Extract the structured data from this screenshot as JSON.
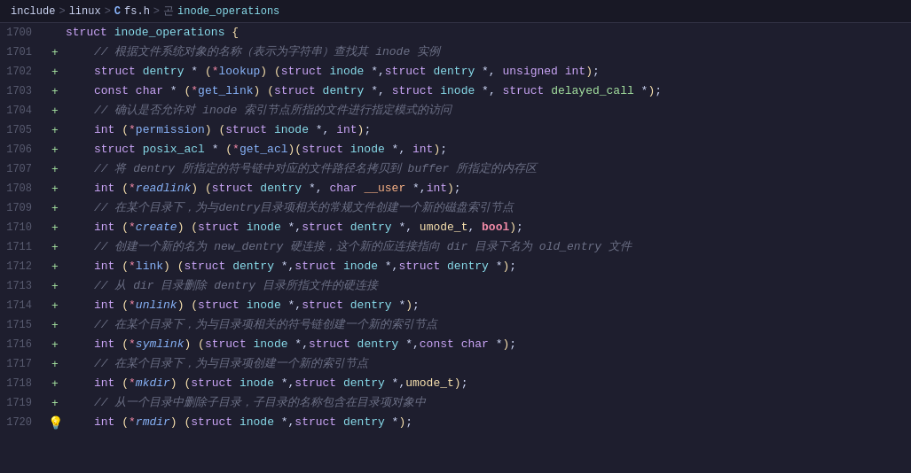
{
  "breadcrumb": {
    "items": [
      "include",
      "linux",
      "fs.h",
      "inode_operations"
    ],
    "separators": [
      ">",
      ">",
      ">"
    ],
    "c_label": "C"
  },
  "lines": [
    {
      "number": "1700",
      "gutter": "",
      "type": "struct-def"
    },
    {
      "number": "1701",
      "gutter": "+",
      "type": "comment",
      "comment": "// 根据文件系统对象的名称（表示为字符串）查找其 inode 实例"
    },
    {
      "number": "1702",
      "gutter": "+",
      "type": "code"
    },
    {
      "number": "1703",
      "gutter": "+",
      "type": "code"
    },
    {
      "number": "1704",
      "gutter": "+",
      "type": "comment",
      "comment": "// 确认是否允许对 inode 索引节点所指的文件进行指定模式的访问"
    },
    {
      "number": "1705",
      "gutter": "+",
      "type": "code"
    },
    {
      "number": "1706",
      "gutter": "+",
      "type": "code"
    },
    {
      "number": "1707",
      "gutter": "+",
      "type": "comment",
      "comment": "// 将 dentry 所指定的符号链中对应的文件路径名拷贝到 buffer 所指定的内存区"
    },
    {
      "number": "1708",
      "gutter": "+",
      "type": "code"
    },
    {
      "number": "1709",
      "gutter": "+",
      "type": "comment",
      "comment": "// 在某个目录下，为与dentry目录项相关的常规文件创建一个新的磁盘索引节点"
    },
    {
      "number": "1710",
      "gutter": "+",
      "type": "code"
    },
    {
      "number": "1711",
      "gutter": "+",
      "type": "comment",
      "comment": "// 创建一个新的名为 new_dentry 硬连接，这个新的应连接指向 dir 目录下名为 old_entry 文件"
    },
    {
      "number": "1712",
      "gutter": "+",
      "type": "code"
    },
    {
      "number": "1713",
      "gutter": "+",
      "type": "comment",
      "comment": "// 从 dir 目录删除 dentry 目录所指文件的硬连接"
    },
    {
      "number": "1714",
      "gutter": "+",
      "type": "code"
    },
    {
      "number": "1715",
      "gutter": "+",
      "type": "comment",
      "comment": "// 在某个目录下，为与目录项相关的符号链创建一个新的索引节点"
    },
    {
      "number": "1716",
      "gutter": "+",
      "type": "code"
    },
    {
      "number": "1717",
      "gutter": "+",
      "type": "comment",
      "comment": "// 在某个目录下，为与目录项创建一个新的索引节点"
    },
    {
      "number": "1718",
      "gutter": "+",
      "type": "code"
    },
    {
      "number": "1719",
      "gutter": "+",
      "type": "comment",
      "comment": "// 从一个目录中删除子目录，子目录的名称包含在目录项对象中"
    },
    {
      "number": "1720",
      "gutter": "bulb",
      "type": "code"
    }
  ]
}
